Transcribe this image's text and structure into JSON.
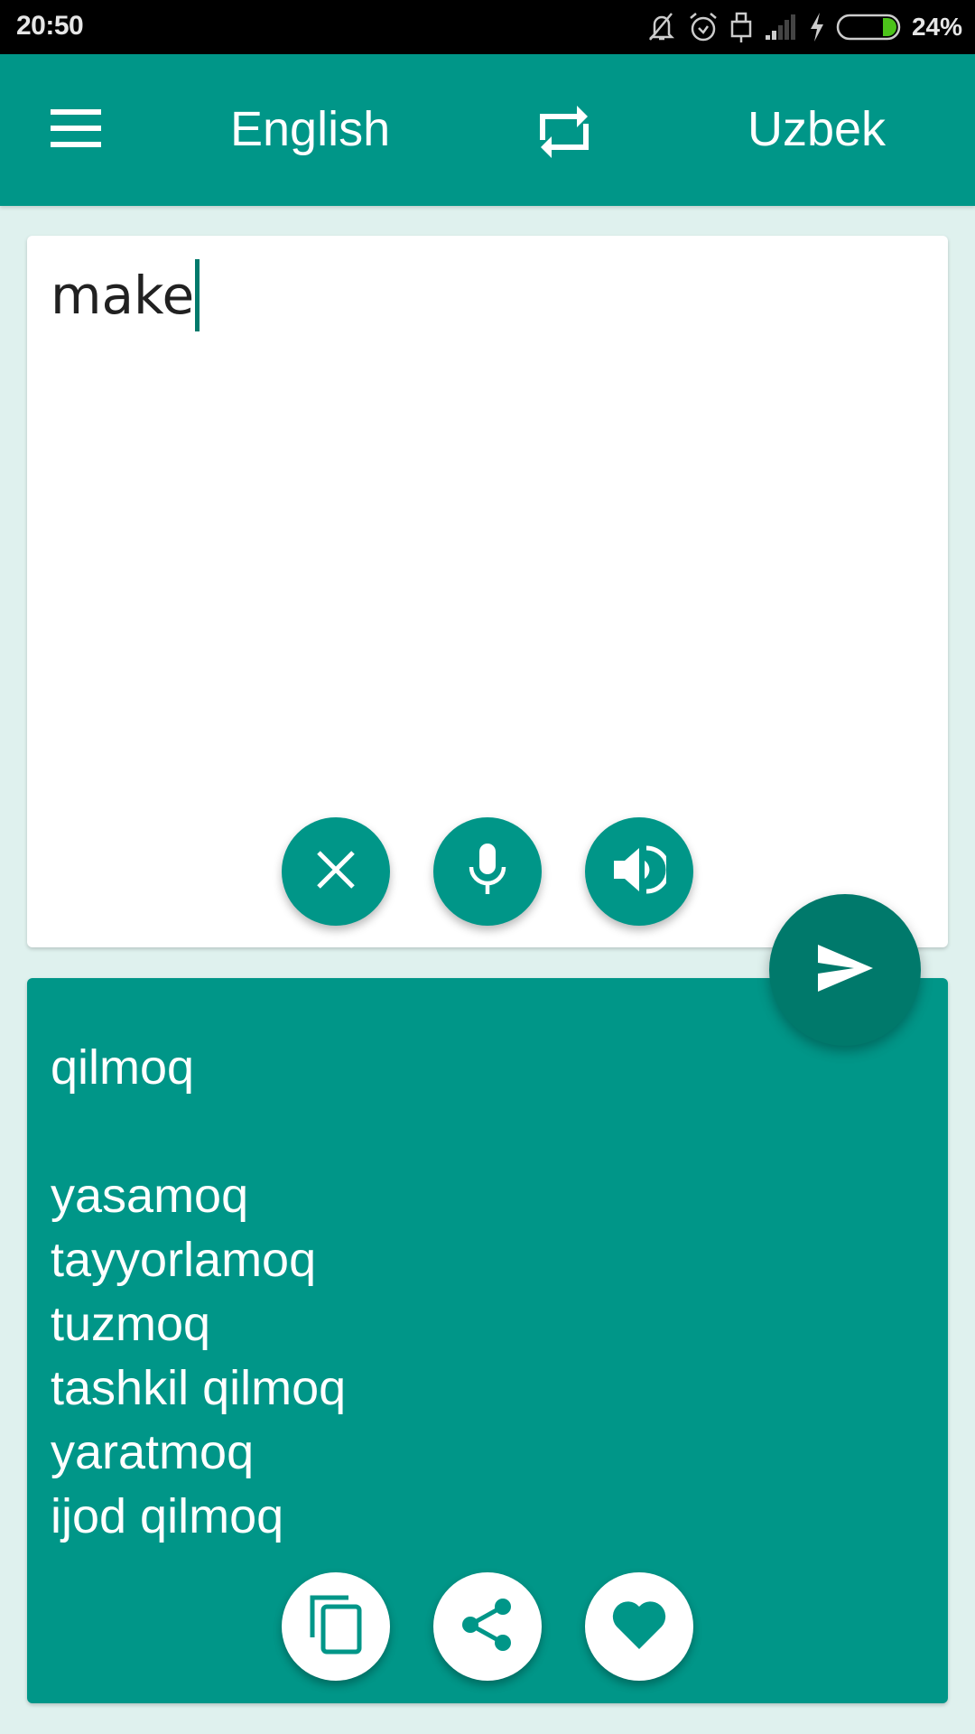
{
  "status_bar": {
    "time": "20:50",
    "icons": [
      "notifications-off-icon",
      "alarm-icon",
      "usb-lock-icon",
      "signal-icon",
      "charging-icon",
      "battery-icon"
    ],
    "battery_percent": "24%",
    "battery_level": 0.24,
    "battery_color": "#4cc31a"
  },
  "app_bar": {
    "menu_icon": "hamburger-menu-icon",
    "source_language": "English",
    "swap_icon": "swap-languages-icon",
    "target_language": "Uzbek",
    "color": "#009688"
  },
  "input": {
    "text": "make",
    "actions": [
      {
        "name": "clear",
        "icon": "close-icon"
      },
      {
        "name": "voice-input",
        "icon": "microphone-icon"
      },
      {
        "name": "speak",
        "icon": "speaker-icon"
      }
    ]
  },
  "translate_button": {
    "icon": "send-icon",
    "color": "#00796b"
  },
  "output": {
    "primary": "qilmoq",
    "alternatives": [
      "yasamoq",
      "tayyorlamoq",
      "tuzmoq",
      "tashkil qilmoq",
      "yaratmoq",
      "ijod qilmoq"
    ],
    "actions": [
      {
        "name": "copy",
        "icon": "copy-icon"
      },
      {
        "name": "share",
        "icon": "share-icon"
      },
      {
        "name": "favorite",
        "icon": "heart-icon"
      }
    ]
  }
}
